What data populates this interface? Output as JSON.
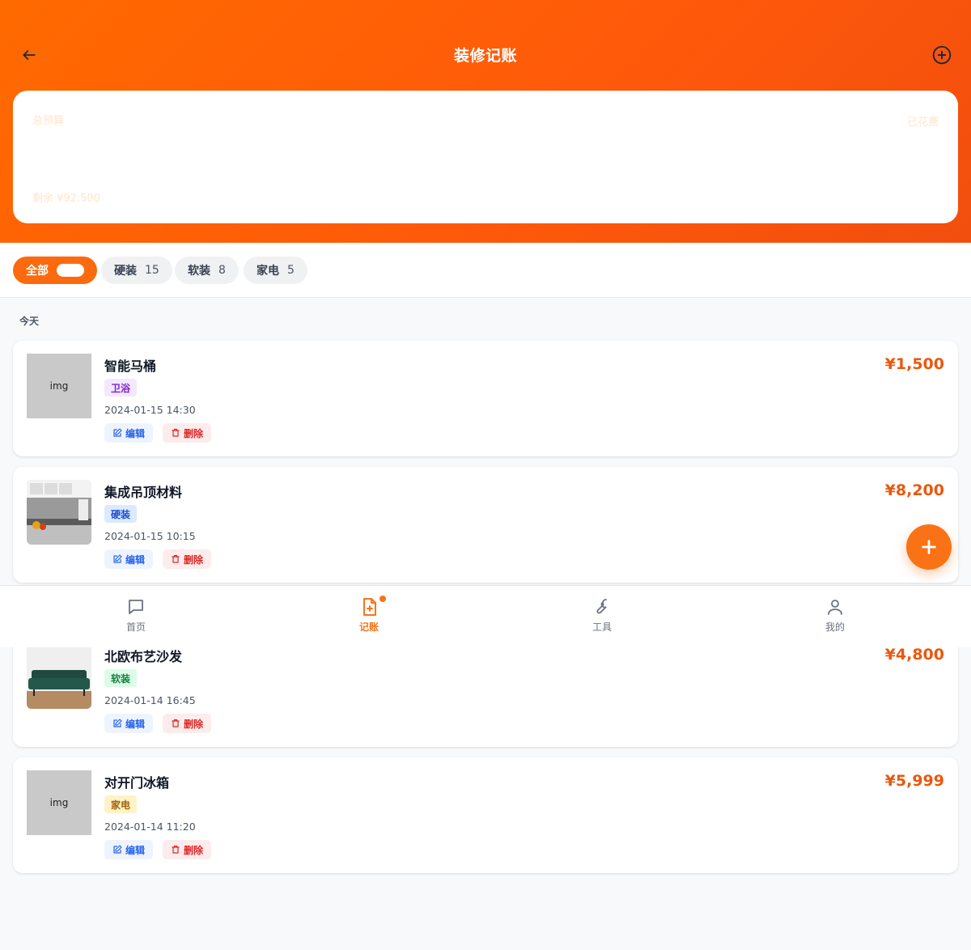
{
  "header": {
    "title": "装修记账",
    "gradient": [
      "#ff6a00",
      "#f24e0e"
    ]
  },
  "budget": {
    "total_label": "总预算",
    "spent_label": "已花费",
    "remaining": "剩余 ¥92,500"
  },
  "filters": [
    {
      "label": "全部",
      "count": "",
      "active": true
    },
    {
      "label": "硬装",
      "count": "15",
      "active": false
    },
    {
      "label": "软装",
      "count": "8",
      "active": false
    },
    {
      "label": "家电",
      "count": "5",
      "active": false
    }
  ],
  "section": {
    "today": "今天"
  },
  "items": [
    {
      "name": "智能马桶",
      "tag": "卫浴",
      "time": "2024-01-15 14:30",
      "price": "¥1,500",
      "thumb_text": "img"
    },
    {
      "name": "集成吊顶材料",
      "tag": "硬装",
      "time": "2024-01-15 10:15",
      "price": "¥8,200",
      "thumb_text": ""
    },
    {
      "name": "北欧布艺沙发",
      "tag": "软装",
      "time": "2024-01-14 16:45",
      "price": "¥4,800",
      "thumb_text": ""
    },
    {
      "name": "对开门冰箱",
      "tag": "家电",
      "time": "2024-01-14 11:20",
      "price": "¥5,999",
      "thumb_text": "img"
    }
  ],
  "actions": {
    "edit": "编辑",
    "delete": "删除"
  },
  "nav": [
    {
      "label": "首页",
      "icon": "chat-icon"
    },
    {
      "label": "记账",
      "icon": "file-plus-icon",
      "active": true
    },
    {
      "label": "工具",
      "icon": "wrench-icon"
    },
    {
      "label": "我的",
      "icon": "user-icon"
    }
  ],
  "colors": {
    "accent": "#f97316",
    "price": "#ea580c"
  }
}
